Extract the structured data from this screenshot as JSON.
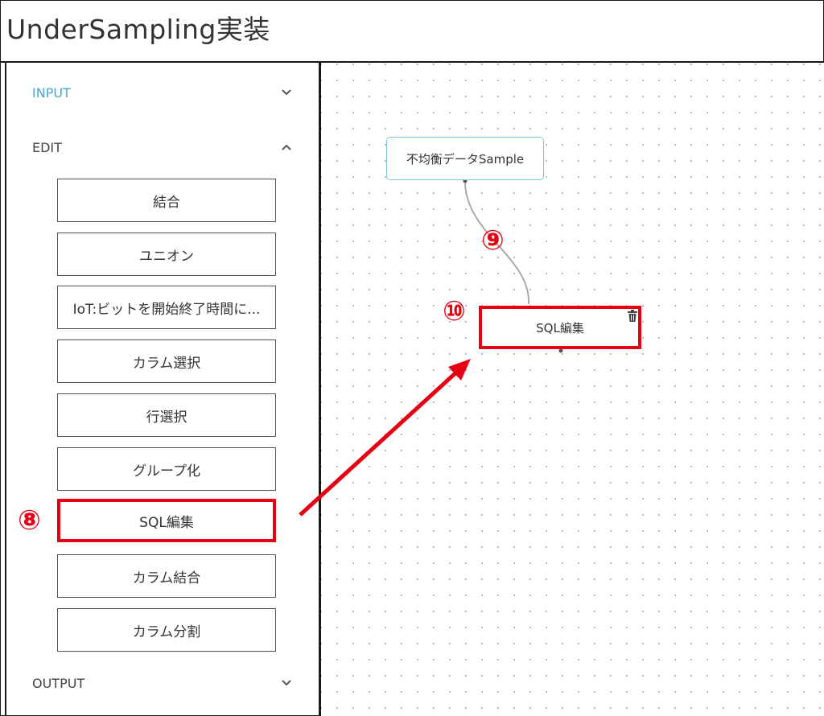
{
  "app": {
    "title": "UnderSampling実装"
  },
  "sidebar": {
    "sections": {
      "input": {
        "label": "INPUT"
      },
      "edit": {
        "label": "EDIT"
      },
      "output": {
        "label": "OUTPUT"
      }
    },
    "edit_items": [
      {
        "label": "結合"
      },
      {
        "label": "ユニオン"
      },
      {
        "label": "IoT:ビットを開始終了時間に..."
      },
      {
        "label": "カラム選択"
      },
      {
        "label": "行選択"
      },
      {
        "label": "グループ化"
      },
      {
        "label": "SQL編集"
      },
      {
        "label": "カラム結合"
      },
      {
        "label": "カラム分割"
      }
    ]
  },
  "canvas": {
    "nodes": {
      "source": {
        "label": "不均衡データSample"
      },
      "sql": {
        "label": "SQL編集"
      }
    }
  },
  "annotations": {
    "step8": "⑧",
    "step9": "⑨",
    "step10": "⑩"
  },
  "colors": {
    "accent_input": "#4aa3c9",
    "highlight": "#e60012",
    "source_node_border": "#7ec3dd"
  }
}
